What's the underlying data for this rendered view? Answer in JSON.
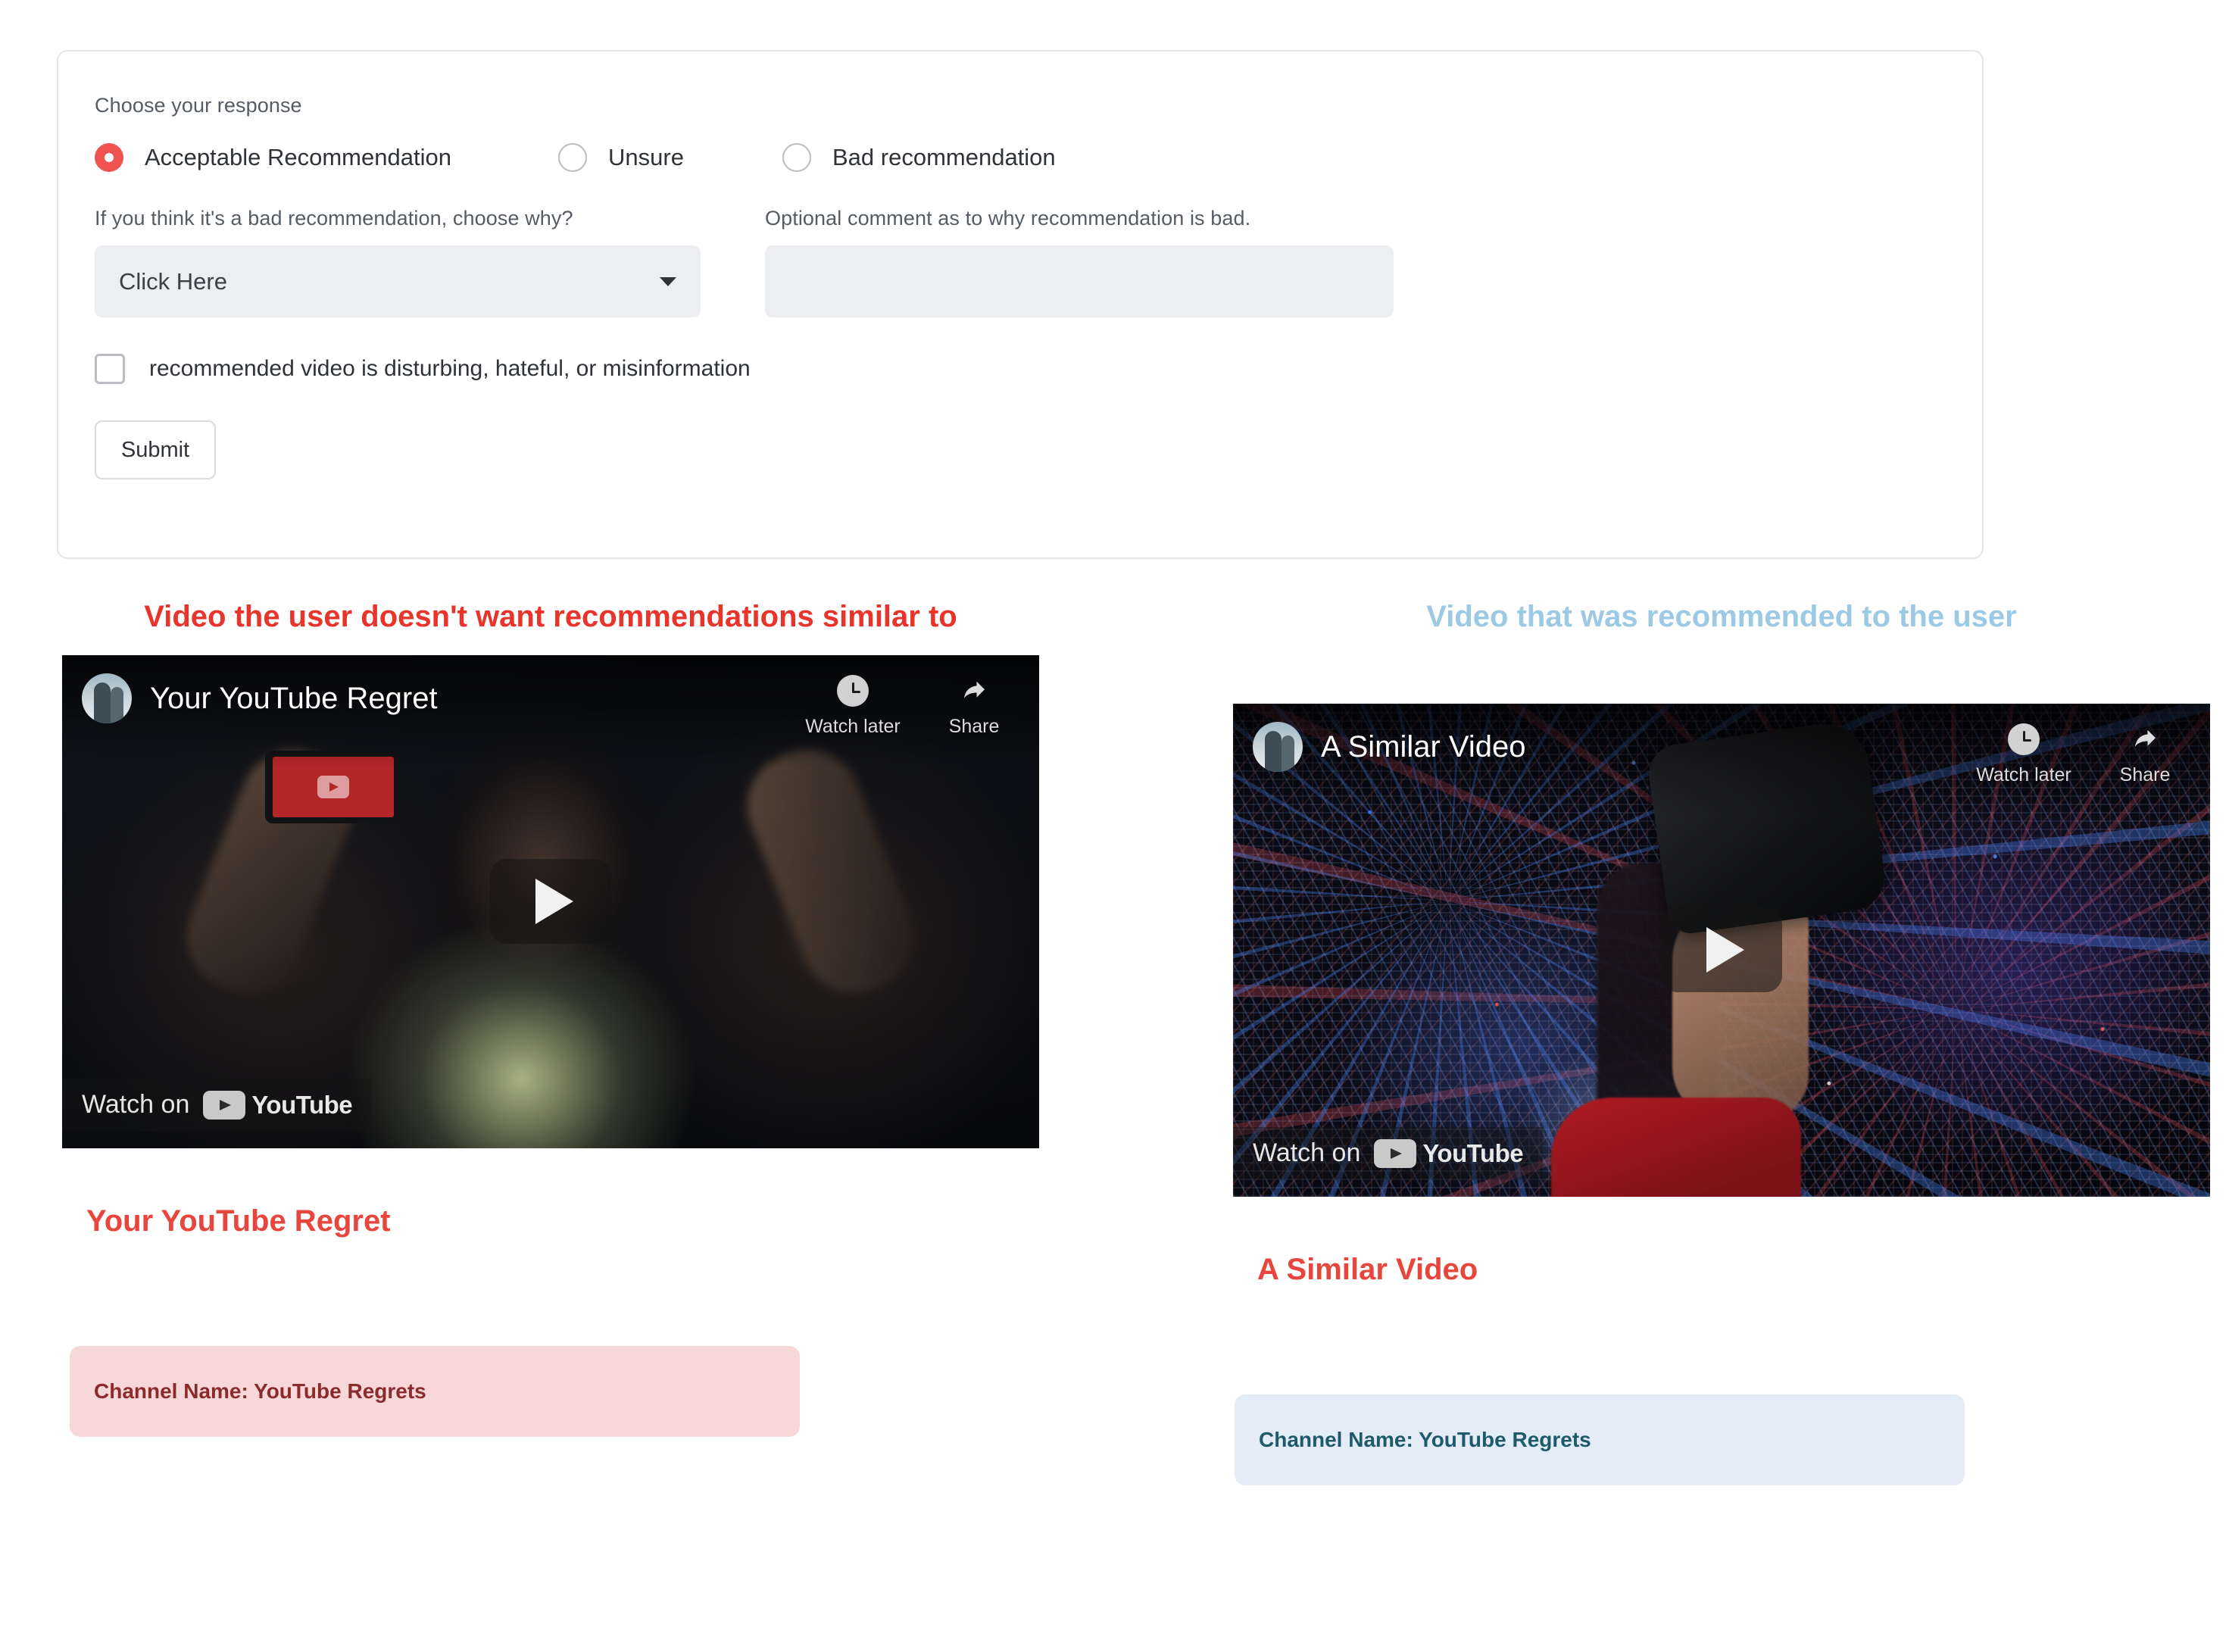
{
  "survey": {
    "response_label": "Choose your response",
    "options": [
      {
        "label": "Acceptable Recommendation",
        "selected": true
      },
      {
        "label": "Unsure",
        "selected": false
      },
      {
        "label": "Bad recommendation",
        "selected": false
      }
    ],
    "reason_label": "If you think it's a bad recommendation, choose why?",
    "reason_value": "Click Here",
    "comment_label": "Optional comment as to why recommendation is bad.",
    "comment_value": "",
    "comment_placeholder": "",
    "checkbox_label": "recommended video is disturbing, hateful, or misinformation",
    "checkbox_checked": false,
    "submit_label": "Submit"
  },
  "left_column": {
    "heading": "Video the user doesn't want recommendations similar to",
    "heading_color": "#e8342a",
    "player": {
      "title": "Your YouTube Regret",
      "watch_later_label": "Watch later",
      "share_label": "Share",
      "watch_on_label": "Watch on",
      "youtube_label": "YouTube"
    },
    "video_title": "Your YouTube Regret",
    "video_title_color": "#e8453c",
    "channel_chip": "Channel Name: YouTube Regrets",
    "chip_bg": "#f8d7d8",
    "chip_text_color": "#8c2b2d"
  },
  "right_column": {
    "heading": "Video that was recommended to the user",
    "heading_color": "#9cc9e3",
    "player": {
      "title": "A Similar Video",
      "watch_later_label": "Watch later",
      "share_label": "Share",
      "watch_on_label": "Watch on",
      "youtube_label": "YouTube"
    },
    "video_title": "A Similar Video",
    "video_title_color": "#e8453c",
    "channel_chip": "Channel Name: YouTube Regrets",
    "chip_bg": "#e4ecf7",
    "chip_text_color": "#1f5a6b"
  }
}
